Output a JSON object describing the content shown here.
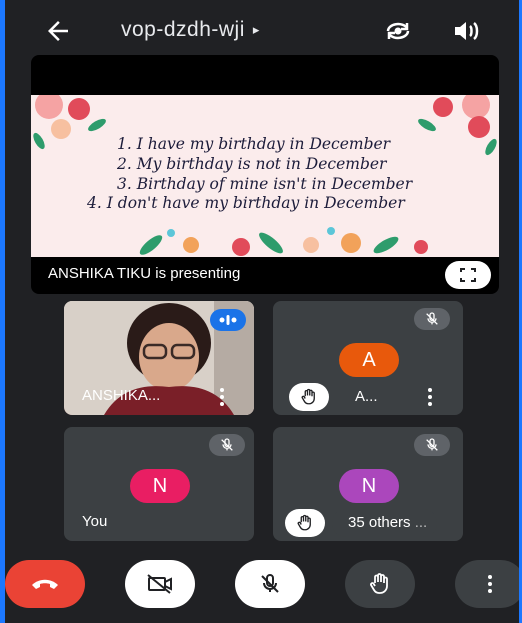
{
  "topbar": {
    "back_icon": "arrow-left-icon",
    "meeting_code": "vop-dzdh-wji",
    "caret": "▸",
    "switch_camera_icon": "camera-switch-icon",
    "audio_icon": "speaker-icon"
  },
  "presentation": {
    "slide_lines": [
      "1.   I have my birthday in December",
      "2.   My birthday is not in December",
      "3.   Birthday of mine isn't in December",
      "4. I don't have my birthday in December"
    ],
    "presenter_label": "ANSHIKA TIKU is presenting",
    "fullscreen_icon": "fullscreen-icon"
  },
  "participants": [
    {
      "name": "ANSHIKA...",
      "has_video": true,
      "speaking": true
    },
    {
      "name": "A...",
      "avatar_letter": "A",
      "avatar_color": "#e8590c",
      "muted": true,
      "hand_raised": true
    },
    {
      "name": "You",
      "avatar_letter": "N",
      "avatar_color": "#e91e63",
      "muted": true
    },
    {
      "name": "35 others",
      "avatar_letter": "N",
      "avatar_color": "#ab47bc",
      "muted": true,
      "hand_raised": true
    }
  ],
  "controls": {
    "end_call_icon": "end-call-icon",
    "camera_icon": "camera-off-icon",
    "mic_icon": "mic-off-icon",
    "hand_icon": "raise-hand-icon",
    "more_icon": "more-vert-icon"
  },
  "colors": {
    "background": "#202124",
    "tile": "#3c4043",
    "end_call": "#ea4335",
    "speaking": "#1a73e8",
    "frame": "#1c78ff"
  }
}
